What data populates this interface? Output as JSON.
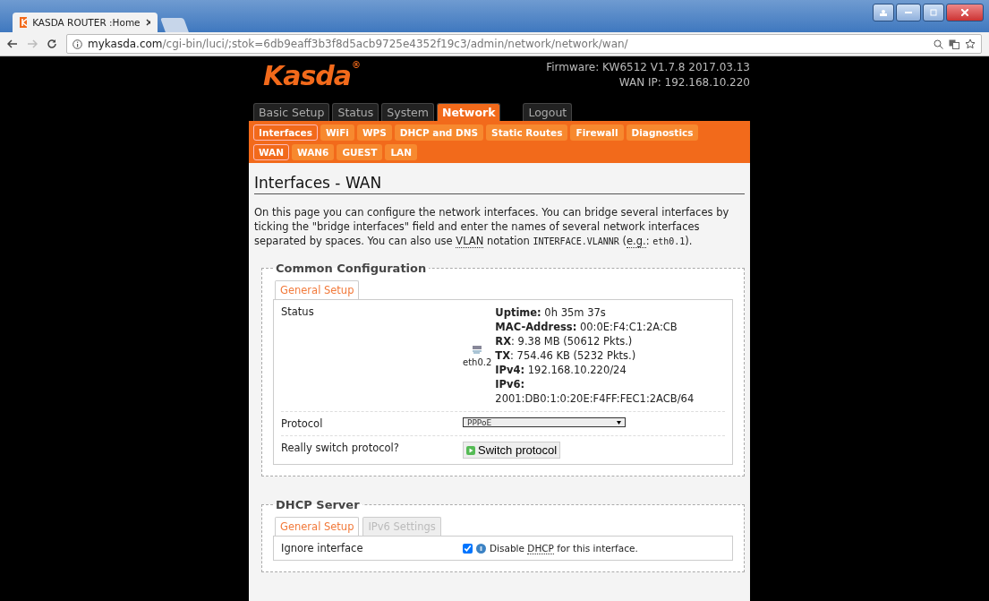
{
  "browser": {
    "tab_title": "KASDA ROUTER :Home",
    "url_host": "mykasda.com",
    "url_path": "/cgi-bin/luci/;stok=6db9eaff3b3f8d5acb9725e4352f19c3/admin/network/network/wan/"
  },
  "header": {
    "logo": "Kasda",
    "registered": "®",
    "firmware": "Firmware: KW6512 V1.7.8 2017.03.13",
    "wan_ip": "WAN IP: 192.168.10.220"
  },
  "main_tabs": [
    {
      "label": "Basic Setup",
      "selected": false
    },
    {
      "label": "Status",
      "selected": false
    },
    {
      "label": "System",
      "selected": false
    },
    {
      "label": "Network",
      "selected": true
    }
  ],
  "logout": "Logout",
  "sub_tabs": [
    {
      "label": "Interfaces",
      "selected": true
    },
    {
      "label": "WiFi",
      "selected": false
    },
    {
      "label": "WPS",
      "selected": false
    },
    {
      "label": "DHCP and DNS",
      "selected": false
    },
    {
      "label": "Static Routes",
      "selected": false
    },
    {
      "label": "Firewall",
      "selected": false
    },
    {
      "label": "Diagnostics",
      "selected": false
    }
  ],
  "interface_tabs": [
    {
      "label": "WAN",
      "selected": true
    },
    {
      "label": "WAN6",
      "selected": false
    },
    {
      "label": "GUEST",
      "selected": false
    },
    {
      "label": "LAN",
      "selected": false
    }
  ],
  "page_title": "Interfaces - WAN",
  "description": [
    {
      "kind": "plain",
      "text": "On this page you can configure the network interfaces. You can bridge several interfaces by ticking the \"bridge interfaces\" field and enter the names of several network interfaces separated by spaces. You can also use "
    },
    {
      "kind": "abbr",
      "text": "VLAN"
    },
    {
      "kind": "plain",
      "text": " notation "
    },
    {
      "kind": "code",
      "text": "INTERFACE.VLANNR"
    },
    {
      "kind": "plain",
      "text": " ("
    },
    {
      "kind": "abbr",
      "text": "e.g."
    },
    {
      "kind": "plain",
      "text": ": "
    },
    {
      "kind": "code",
      "text": "eth0.1"
    },
    {
      "kind": "plain",
      "text": ")."
    }
  ],
  "sections": [
    {
      "legend": "Common Configuration",
      "tabs": [
        {
          "label": "General Setup",
          "selected": true
        }
      ],
      "rows": [
        {
          "kind": "status",
          "label": "Status",
          "device": "eth0.2",
          "lines": [
            "**Uptime:** 0h 35m 37s",
            "**MAC-Address:** 00:0E:F4:C1:2A:CB",
            "**RX**: 9.38 MB (50612 Pkts.)",
            "**TX**: 754.46 KB (5232 Pkts.)",
            "**IPv4:** 192.168.10.220/24",
            "**IPv6:**",
            "2001:DB0:1:0:20E:F4FF:FEC1:2ACB/64"
          ]
        },
        {
          "kind": "select",
          "label": "Protocol",
          "value": "PPPoE"
        },
        {
          "kind": "button",
          "label": "Really switch protocol?",
          "button": "Switch protocol"
        }
      ]
    },
    {
      "legend": "DHCP Server",
      "tabs": [
        {
          "label": "General Setup",
          "selected": true
        },
        {
          "label": "IPv6 Settings",
          "selected": false
        }
      ],
      "rows": [
        {
          "kind": "checkbox",
          "label": "Ignore interface",
          "checked": true,
          "text": [
            {
              "kind": "plain",
              "text": "Disable "
            },
            {
              "kind": "abbr",
              "text": "DHCP"
            },
            {
              "kind": "plain",
              "text": " for this interface."
            }
          ]
        }
      ]
    }
  ]
}
